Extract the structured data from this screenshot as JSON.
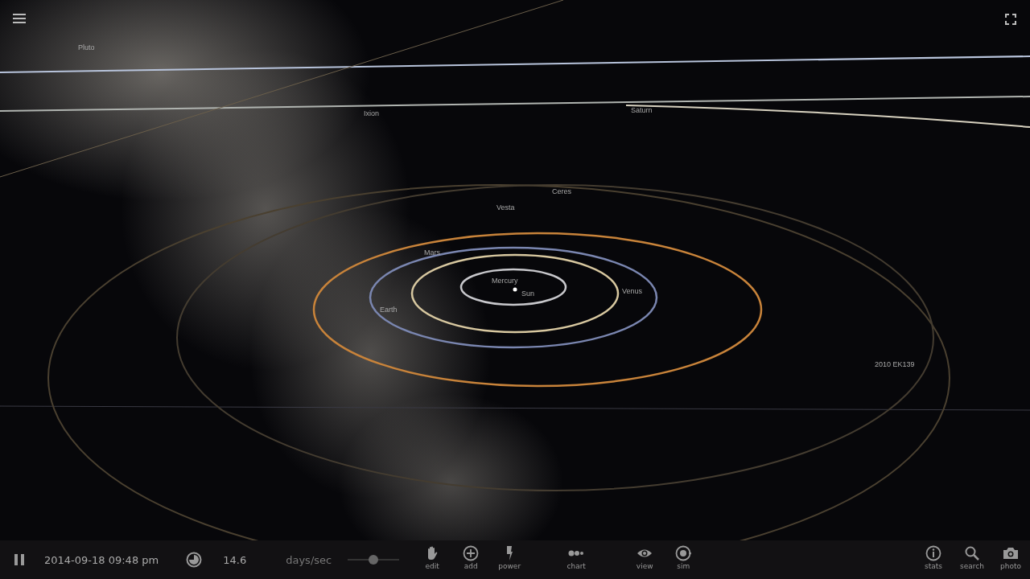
{
  "space_view": {
    "labels": [
      "Pluto",
      "Ixion",
      "Saturn",
      "Ceres",
      "Vesta",
      "Mars",
      "Mercury",
      "Sun",
      "Venus",
      "Earth",
      "2010 EK139"
    ]
  },
  "toolbar": {
    "date": "2014-09-18 09:48 pm",
    "speed": "14.6",
    "speed_unit": "days/sec",
    "speed_slider": {
      "level": 0.5
    },
    "edit_tools": [
      {
        "kind": "hand",
        "label": "edit"
      },
      {
        "kind": "add",
        "label": "add"
      },
      {
        "kind": "power",
        "label": "power"
      }
    ],
    "chart_tools": [
      {
        "kind": "chart",
        "label": "chart"
      }
    ],
    "view_tools": [
      {
        "kind": "eye",
        "label": "view"
      },
      {
        "kind": "sim",
        "label": "sim"
      }
    ],
    "right_tools": [
      {
        "kind": "info",
        "label": "stats"
      },
      {
        "kind": "search",
        "label": "search"
      },
      {
        "kind": "camera",
        "label": "photo"
      }
    ]
  }
}
